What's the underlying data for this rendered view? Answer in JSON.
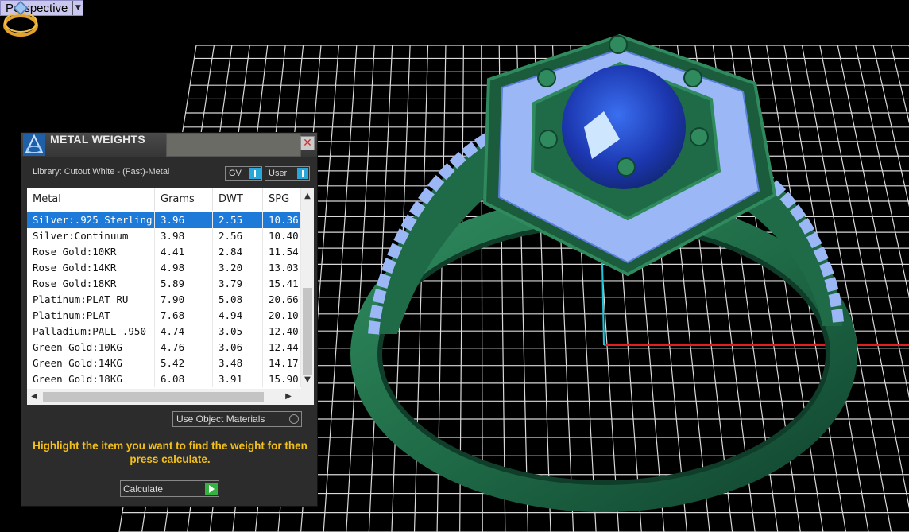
{
  "viewport": {
    "view_label": "Perspective",
    "nav_icon": "ring-navigation-icon",
    "colors": {
      "grid": "#d9d9d9",
      "background": "#000000",
      "metal": "#1f6b47",
      "stones": "#9bb7f5",
      "center_stone": "#1f3fb8",
      "x_axis": "#e02020",
      "z_axis": "#22c4d8"
    }
  },
  "panel": {
    "title": "METAL WEIGHTS",
    "logo_icon": "app-logo-icon",
    "close_icon": "close-icon",
    "library": "Library: Cutout White - (Fast)-Metal",
    "toggle_gv": "GV",
    "toggle_user": "User",
    "columns": [
      "Metal",
      "Grams",
      "DWT",
      "SPG"
    ],
    "rows": [
      [
        "Silver:.925 Sterling",
        "3.96",
        "2.55",
        "10.36"
      ],
      [
        "Silver:Continuum",
        "3.98",
        "2.56",
        "10.40"
      ],
      [
        "Rose Gold:10KR",
        "4.41",
        "2.84",
        "11.54"
      ],
      [
        "Rose Gold:14KR",
        "4.98",
        "3.20",
        "13.03"
      ],
      [
        "Rose Gold:18KR",
        "5.89",
        "3.79",
        "15.41"
      ],
      [
        "Platinum:PLAT RU",
        "7.90",
        "5.08",
        "20.66"
      ],
      [
        "Platinum:PLAT",
        "7.68",
        "4.94",
        "20.10"
      ],
      [
        "Palladium:PALL .950",
        "4.74",
        "3.05",
        "12.40"
      ],
      [
        "Green Gold:10KG",
        "4.76",
        "3.06",
        "12.44"
      ],
      [
        "Green Gold:14KG",
        "5.42",
        "3.48",
        "14.17"
      ],
      [
        "Green Gold:18KG",
        "6.08",
        "3.91",
        "15.90"
      ]
    ],
    "selected_row": 0,
    "use_object_materials": "Use Object Materials",
    "hint": "Highlight the item you want to find the weight for then press calculate.",
    "calculate": "Calculate"
  }
}
